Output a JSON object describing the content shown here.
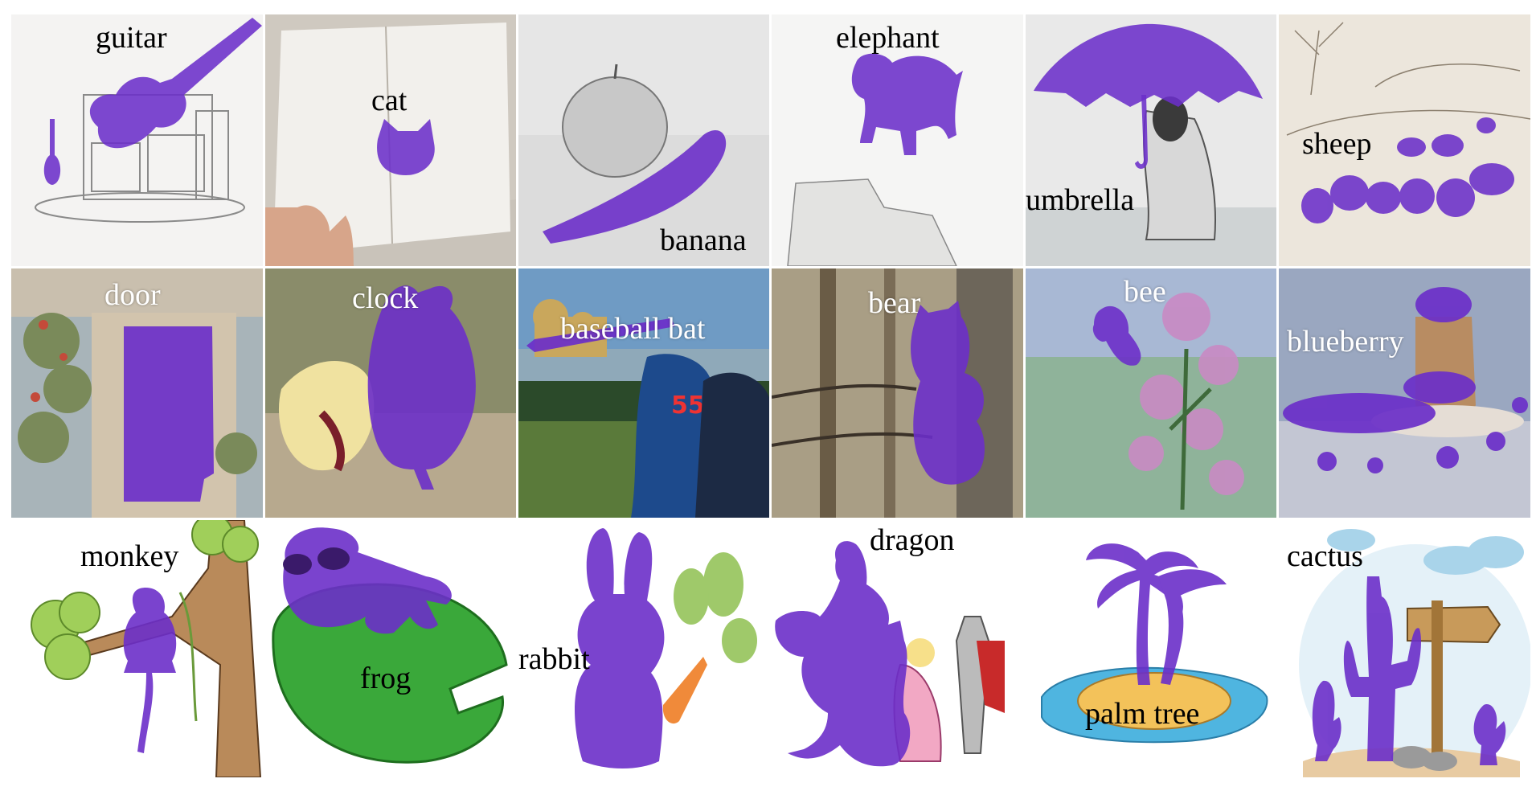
{
  "colors": {
    "mask": "#6b2fc9",
    "background": "#ffffff",
    "label_dark": "#000000",
    "label_light": "#ffffff"
  },
  "rows": [
    {
      "style": "pencil sketches",
      "tiles": [
        {
          "label": "guitar",
          "object_icon": "guitar-icon"
        },
        {
          "label": "cat",
          "object_icon": "cat-icon"
        },
        {
          "label": "banana",
          "object_icon": "banana-icon"
        },
        {
          "label": "elephant",
          "object_icon": "elephant-icon"
        },
        {
          "label": "umbrella",
          "object_icon": "umbrella-icon"
        },
        {
          "label": "sheep",
          "object_icon": "sheep-icon"
        }
      ]
    },
    {
      "style": "paintings",
      "tiles": [
        {
          "label": "door",
          "object_icon": "door-icon"
        },
        {
          "label": "clock",
          "object_icon": "clock-icon"
        },
        {
          "label": "baseball bat",
          "object_icon": "baseball-bat-icon"
        },
        {
          "label": "bear",
          "object_icon": "bear-icon"
        },
        {
          "label": "bee",
          "object_icon": "bee-icon"
        },
        {
          "label": "blueberry",
          "object_icon": "blueberry-icon"
        }
      ]
    },
    {
      "style": "clipart",
      "tiles": [
        {
          "label": "monkey",
          "object_icon": "monkey-icon"
        },
        {
          "label": "frog",
          "object_icon": "frog-icon"
        },
        {
          "label": "rabbit",
          "object_icon": "rabbit-icon"
        },
        {
          "label": "dragon",
          "object_icon": "dragon-icon"
        },
        {
          "label": "palm tree",
          "object_icon": "palm-tree-icon"
        },
        {
          "label": "cactus",
          "object_icon": "cactus-icon"
        }
      ]
    }
  ]
}
